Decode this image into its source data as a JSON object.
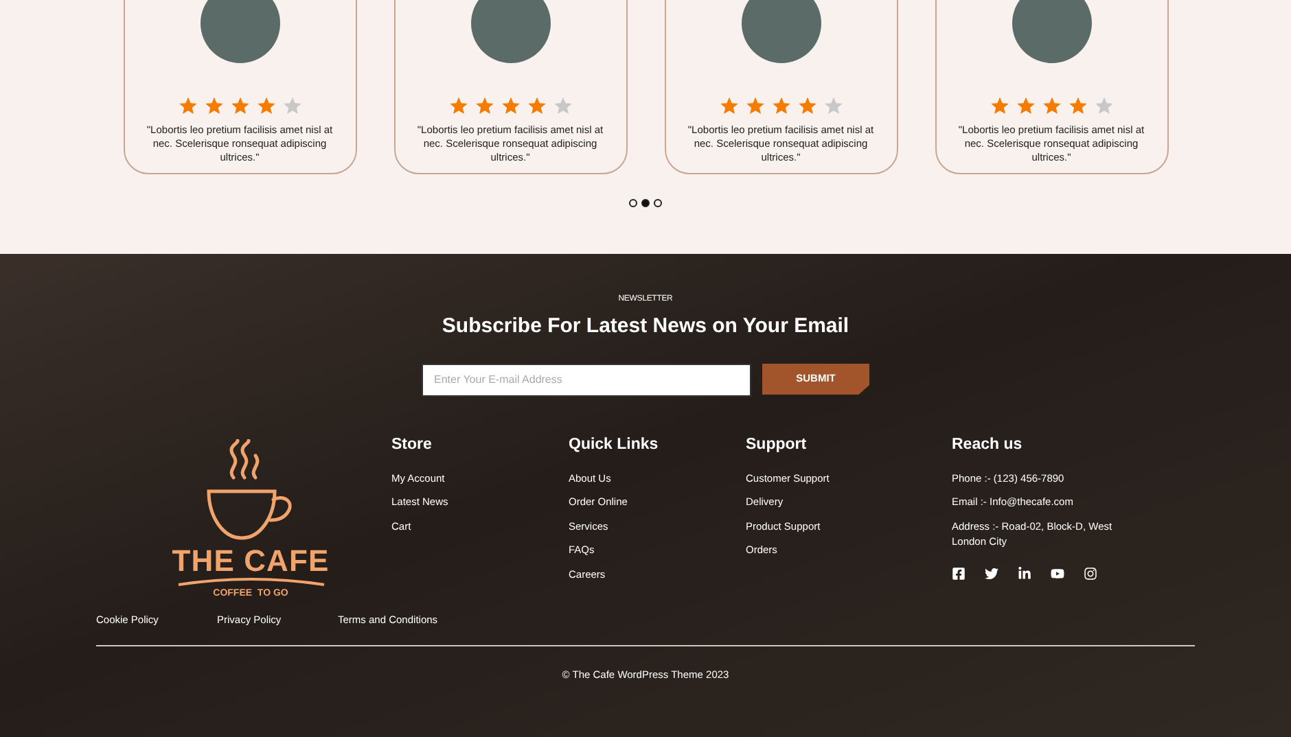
{
  "testimonials": [
    {
      "stars": 4,
      "quote": "\"Lobortis leo pretium facilisis amet nisl at nec. Scelerisque ronsequat adipiscing ultrices.\""
    },
    {
      "stars": 4,
      "quote": "\"Lobortis leo pretium facilisis amet nisl at nec. Scelerisque ronsequat adipiscing ultrices.\""
    },
    {
      "stars": 4,
      "quote": "\"Lobortis leo pretium facilisis amet nisl at nec. Scelerisque ronsequat adipiscing ultrices.\""
    },
    {
      "stars": 4,
      "quote": "\"Lobortis leo pretium facilisis amet nisl at nec. Scelerisque ronsequat adipiscing ultrices.\""
    }
  ],
  "carousel_dots": [
    {
      "selected": false
    },
    {
      "selected": true
    },
    {
      "selected": false
    }
  ],
  "newsletter": {
    "eyebrow": "NEWSLETTER",
    "title": "Subscribe For Latest News on Your Email",
    "placeholder": "Enter Your E-mail Address",
    "button": "SUBMIT"
  },
  "logo": {
    "name": "THE CAFE",
    "tagline": "COFFEE  TO GO"
  },
  "columns": [
    {
      "title": "Store",
      "links": [
        "My Account",
        "Latest News",
        "Cart"
      ]
    },
    {
      "title": "Quick Links",
      "links": [
        "About Us",
        "Order Online",
        "Services",
        "FAQs",
        "Careers"
      ]
    },
    {
      "title": "Support",
      "links": [
        "Customer Support",
        "Delivery",
        "Product Support",
        "Orders"
      ]
    }
  ],
  "contact": {
    "title": "Reach us",
    "lines": [
      "Phone :- (123) 456-7890",
      "Email :- Info@thecafe.com",
      "Address :- Road-02, Block-D, West London City"
    ]
  },
  "legal_links": [
    "Cookie Policy",
    "Privacy Policy",
    "Terms and Conditions"
  ],
  "copyright": "© The Cafe WordPress Theme 2023"
}
